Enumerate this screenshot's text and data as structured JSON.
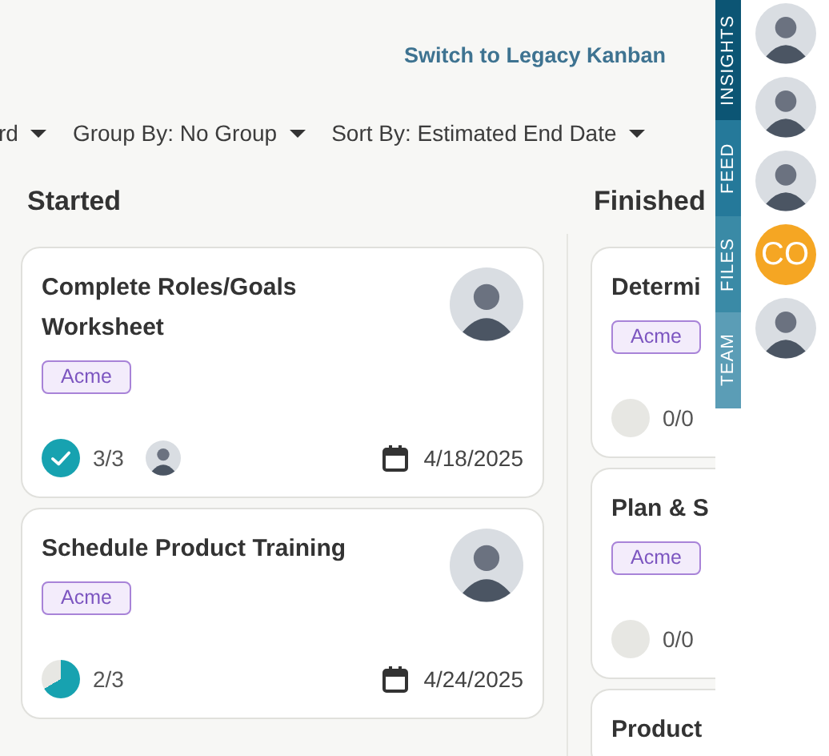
{
  "header": {
    "link": "Switch to Legacy Kanban"
  },
  "filters": [
    {
      "label": "rd"
    },
    {
      "label": "Group By: No Group"
    },
    {
      "label": "Sort By: Estimated End Date"
    }
  ],
  "columns": [
    {
      "title": "Started",
      "cards": [
        {
          "title": "Complete Roles/Goals Worksheet",
          "tag": "Acme",
          "assignee": {
            "kind": "photo"
          },
          "progress": {
            "text": "3/3"
          },
          "collaborators": [
            {
              "kind": "photo"
            }
          ],
          "due_date": "4/18/2025"
        },
        {
          "title": "Schedule Product Training",
          "tag": "Acme",
          "assignee": {
            "kind": "photo"
          },
          "progress": {
            "text": "2/3"
          },
          "due_date": "4/24/2025"
        }
      ]
    },
    {
      "title": "Finished",
      "cards": [
        {
          "title": "Determi",
          "tag": "Acme",
          "progress": {
            "text": "0/0"
          }
        },
        {
          "title": "Plan & S",
          "tag": "Acme",
          "progress": {
            "text": "0/0"
          }
        },
        {
          "title": "Product"
        }
      ]
    }
  ],
  "side_tabs": [
    {
      "label": "INSIGHTS",
      "selected": true
    },
    {
      "label": "FEED",
      "selected": false
    },
    {
      "label": "FILES",
      "selected": false
    },
    {
      "label": "TEAM",
      "selected": false
    }
  ],
  "people": [
    {
      "kind": "photo"
    },
    {
      "kind": "photo"
    },
    {
      "kind": "photo"
    },
    {
      "kind": "initials",
      "initials": "CO",
      "color": "#f5a623"
    },
    {
      "kind": "photo"
    }
  ]
}
